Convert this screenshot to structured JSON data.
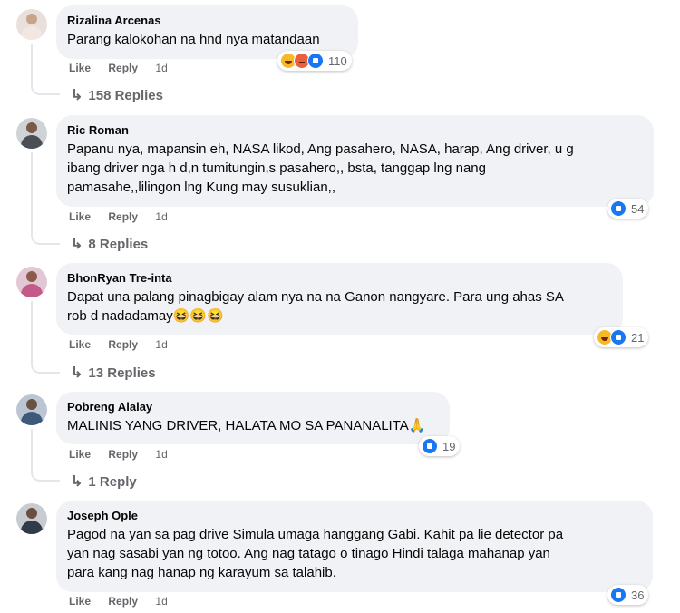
{
  "actions": {
    "like": "Like",
    "reply": "Reply"
  },
  "comments": [
    {
      "author": "Rizalina Arcenas",
      "text_lines": [
        "Parang kalokohan na hnd nya matandaan"
      ],
      "time": "1d",
      "reactions": [
        "haha",
        "angry",
        "like"
      ],
      "reaction_count": "110",
      "replies": "158 Replies",
      "avatar_colors": {
        "bg": "#e8e0dc",
        "head": "#c9a38a",
        "body": "#f3e7e1"
      }
    },
    {
      "author": "Ric Roman",
      "text_lines": [
        "Papanu nya, mapansin eh, NASA likod, Ang pasahero, NASA, harap, Ang driver, u g",
        "ibang driver nga h d,n tumitungin,s pasahero,, bsta, tanggap lng nang",
        "pamasahe,,lilingon lng Kung may susuklian,,"
      ],
      "time": "1d",
      "reactions": [
        "like"
      ],
      "reaction_count": "54",
      "replies": "8 Replies",
      "avatar_colors": {
        "bg": "#cfd3d6",
        "head": "#7a5a45",
        "body": "#4a4f55"
      }
    },
    {
      "author": "BhonRyan Tre-inta",
      "text_lines": [
        "Dapat una palang pinagbigay alam nya na na Ganon nangyare. Para ung ahas SA",
        "rob d nadadamay😆😆😆"
      ],
      "time": "1d",
      "reactions": [
        "haha",
        "like"
      ],
      "reaction_count": "21",
      "replies": "13 Replies",
      "avatar_colors": {
        "bg": "#e2c7d5",
        "head": "#8a5a4a",
        "body": "#c45a8a"
      }
    },
    {
      "author": "Pobreng Alalay",
      "text_lines": [
        "MALINIS YANG DRIVER, HALATA MO SA PANANALITA🙏"
      ],
      "time": "1d",
      "reactions": [
        "like"
      ],
      "reaction_count": "19",
      "replies": "1 Reply",
      "avatar_colors": {
        "bg": "#bcc6d2",
        "head": "#6a5242",
        "body": "#3e5a7a"
      }
    },
    {
      "author": "Joseph Ople",
      "text_lines": [
        "Pagod na yan sa pag drive Simula umaga hanggang Gabi. Kahit pa lie detector pa",
        "yan nag sasabi yan ng totoo. Ang nag tatago o tinago Hindi talaga mahanap yan",
        "para kang nag hanap ng karayum sa talahib."
      ],
      "time": "1d",
      "reactions": [
        "like"
      ],
      "reaction_count": "36",
      "replies": "",
      "avatar_colors": {
        "bg": "#c8ccd2",
        "head": "#6b4f3d",
        "body": "#2f3a4a"
      }
    }
  ]
}
